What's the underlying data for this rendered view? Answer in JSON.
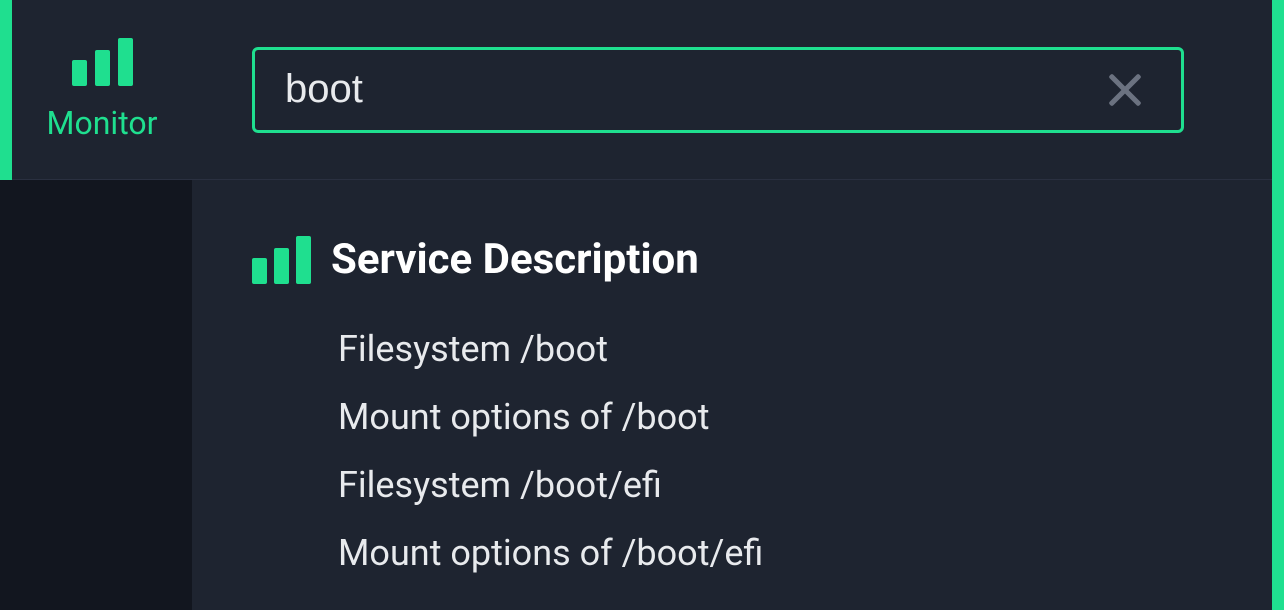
{
  "sidebar": {
    "label": "Monitor"
  },
  "search": {
    "value": "boot",
    "placeholder": ""
  },
  "section": {
    "title": "Service Description"
  },
  "results": [
    {
      "text": "Filesystem /boot"
    },
    {
      "text": "Mount options of /boot"
    },
    {
      "text": "Filesystem /boot/efi"
    },
    {
      "text": "Mount options of /boot/efi"
    }
  ]
}
